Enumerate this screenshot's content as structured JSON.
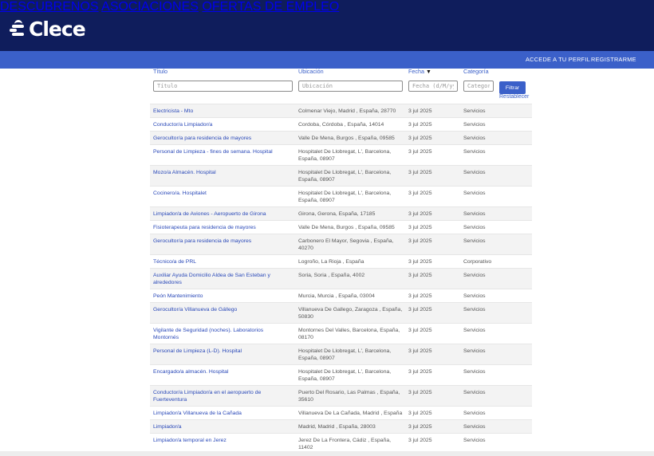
{
  "brand": {
    "name": "Clece"
  },
  "nav": {
    "main": [
      "DESCUBRENOS",
      "ASOCIACIONES",
      "OFERTAS DE EMPLEO"
    ],
    "sub": [
      "ACCEDE A TU PERFIL",
      "REGISTRARME"
    ]
  },
  "filters": {
    "headers": {
      "title": "Título",
      "location": "Ubicación",
      "date": "Fecha",
      "category": "Categoría"
    },
    "sort_indicator": "▼",
    "placeholders": {
      "title": "Título",
      "location": "Ubicación",
      "date": "Fecha (d/M/yy)",
      "category": "Categoría"
    },
    "filter_button": "Filtrar",
    "reset_link": "Restablecer"
  },
  "jobs": [
    {
      "title": "Electricista - Mto",
      "location": "Colmenar Viejo, Madrid , España, 28770",
      "date": "3 jul 2025",
      "category": "Servicios"
    },
    {
      "title": "Conductor/a Limpiador/a",
      "location": "Cordoba, Córdoba , España, 14014",
      "date": "3 jul 2025",
      "category": "Servicios"
    },
    {
      "title": "Gerocultor/a para residencia de mayores",
      "location": "Valle De Mena, Burgos , España, 09585",
      "date": "3 jul 2025",
      "category": "Servicios"
    },
    {
      "title": "Personal de Limpieza - fines de semana. Hospital",
      "location": "Hospitalet De Llobregat, L', Barcelona, España, 08907",
      "date": "3 jul 2025",
      "category": "Servicios"
    },
    {
      "title": "Mozo/a Almacén. Hospital",
      "location": "Hospitalet De Llobregat, L', Barcelona, España, 08907",
      "date": "3 jul 2025",
      "category": "Servicios"
    },
    {
      "title": "Cocinero/a. Hospitalet",
      "location": "Hospitalet De Llobregat, L', Barcelona, España, 08907",
      "date": "3 jul 2025",
      "category": "Servicios"
    },
    {
      "title": "Limpiador/a de Aviones - Aeropuerto de Girona",
      "location": "Girona, Gerona, España, 17185",
      "date": "3 jul 2025",
      "category": "Servicios"
    },
    {
      "title": "Fisioterapeuta para residencia de mayores",
      "location": "Valle De Mena, Burgos , España, 09585",
      "date": "3 jul 2025",
      "category": "Servicios"
    },
    {
      "title": "Gerocultor/a para residencia de mayores",
      "location": "Carbonero El Mayor, Segovia , España, 40270",
      "date": "3 jul 2025",
      "category": "Servicios"
    },
    {
      "title": "Técnico/a de PRL",
      "location": "Logroño, La Rioja , España",
      "date": "3 jul 2025",
      "category": "Corporativo"
    },
    {
      "title": "Auxiliar Ayuda Domicilio Aldea de San Esteban y alrededores",
      "location": "Soria, Soria , España, 4002",
      "date": "3 jul 2025",
      "category": "Servicios"
    },
    {
      "title": "Peón Mantenimiento",
      "location": "Murcia, Murcia , España, 03004",
      "date": "3 jul 2025",
      "category": "Servicios"
    },
    {
      "title": "Gerocultor/a Villanueva de Gállego",
      "location": "Villanueva De Gallego, Zaragoza , España, 50830",
      "date": "3 jul 2025",
      "category": "Servicios"
    },
    {
      "title": "Vigilante de Seguridad (noches). Laboratorios Montornés",
      "location": "Montornes Del Valles, Barcelona, España, 08170",
      "date": "3 jul 2025",
      "category": "Servicios"
    },
    {
      "title": "Personal de Limpieza (L-D). Hospital",
      "location": "Hospitalet De Llobregat, L', Barcelona, España, 08907",
      "date": "3 jul 2025",
      "category": "Servicios"
    },
    {
      "title": "Encargado/a almacén. Hospital",
      "location": "Hospitalet De Llobregat, L', Barcelona, España, 08907",
      "date": "3 jul 2025",
      "category": "Servicios"
    },
    {
      "title": "Conductor/a Limpiador/a en el aeropuerto de Fuerteventura",
      "location": "Puerto Del Rosario, Las Palmas , España, 35610",
      "date": "3 jul 2025",
      "category": "Servicios"
    },
    {
      "title": "Limpiador/a Villanueva de la Cañada",
      "location": "Villanueva De La Cañada, Madrid , España",
      "date": "3 jul 2025",
      "category": "Servicios"
    },
    {
      "title": "Limpiador/a",
      "location": "Madrid, Madrid , España, 28003",
      "date": "3 jul 2025",
      "category": "Servicios"
    },
    {
      "title": "Limpiador/a temporal en Jerez",
      "location": "Jerez De La Frontera, Cádiz , España, 11402",
      "date": "3 jul 2025",
      "category": "Servicios"
    }
  ]
}
